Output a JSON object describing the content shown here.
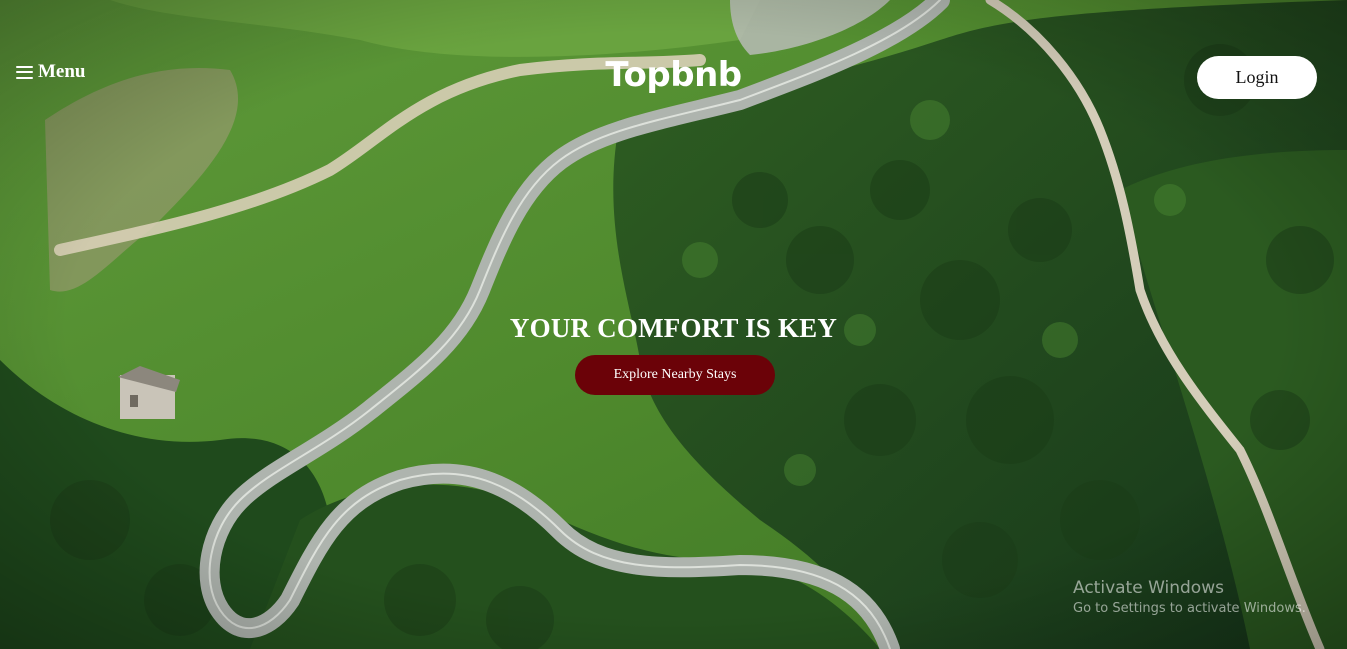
{
  "nav": {
    "menu_label": "Menu",
    "brand": "Topbnb",
    "login_label": "Login"
  },
  "hero": {
    "heading": "YOUR COMFORT IS KEY",
    "cta_label": "Explore Nearby Stays",
    "background_subject": "aerial-mountain-road-forest"
  },
  "os_watermark": {
    "title": "Activate Windows",
    "subtitle": "Go to Settings to activate Windows."
  },
  "colors": {
    "cta_background": "#6b0208",
    "login_background": "#ffffff",
    "text_primary": "#ffffff"
  },
  "icons": {
    "menu": "hamburger-icon"
  }
}
